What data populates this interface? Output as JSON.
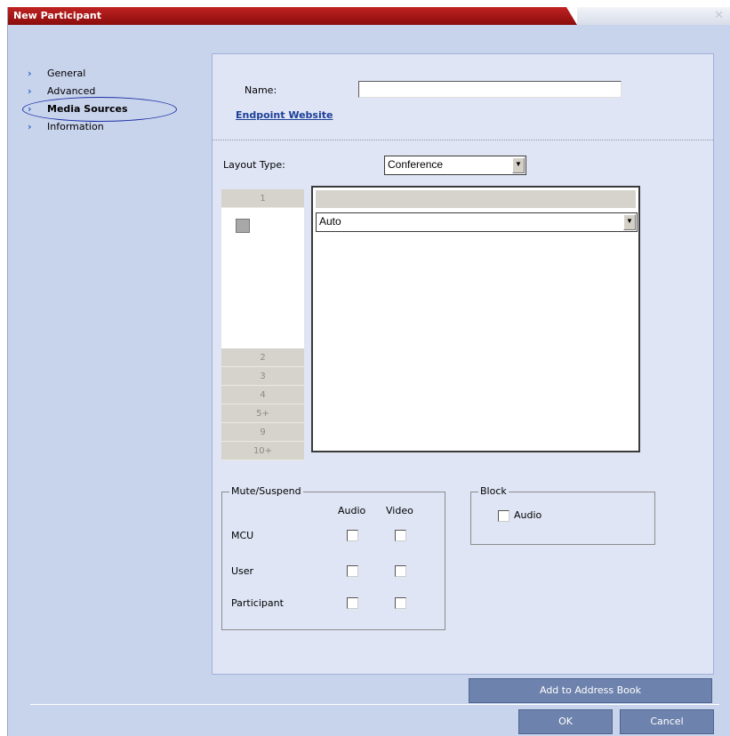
{
  "window": {
    "title": "New Participant",
    "close_icon": "close-icon"
  },
  "nav": {
    "items": [
      {
        "label": "General",
        "icon": "chevron-right-icon",
        "active": false
      },
      {
        "label": "Advanced",
        "icon": "chevron-right-icon",
        "active": false
      },
      {
        "label": "Media Sources",
        "icon": "chevron-right-icon",
        "active": true
      },
      {
        "label": "Information",
        "icon": "chevron-right-icon",
        "active": false
      }
    ]
  },
  "form": {
    "name_label": "Name:",
    "name_value": "",
    "endpoint_link": "Endpoint Website",
    "layout_type_label": "Layout Type:",
    "layout_type_value": "Conference",
    "layout_buttons": [
      "1",
      "2",
      "3",
      "4",
      "5+",
      "9",
      "10+"
    ],
    "cell_source_value": "Auto"
  },
  "mute": {
    "legend": "Mute/Suspend",
    "col_audio": "Audio",
    "col_video": "Video",
    "rows": [
      {
        "label": "MCU",
        "audio": false,
        "video": false
      },
      {
        "label": "User",
        "audio": false,
        "video": false
      },
      {
        "label": "Participant",
        "audio": false,
        "video": false
      }
    ]
  },
  "block": {
    "legend": "Block",
    "audio_label": "Audio",
    "audio": false
  },
  "buttons": {
    "add_to_address_book": "Add to Address Book",
    "ok": "OK",
    "cancel": "Cancel"
  },
  "colors": {
    "title_bar": "#a51515",
    "window_bg": "#c8d3ec",
    "panel_bg": "#dfe5f5",
    "button_bg": "#6d82ac"
  }
}
